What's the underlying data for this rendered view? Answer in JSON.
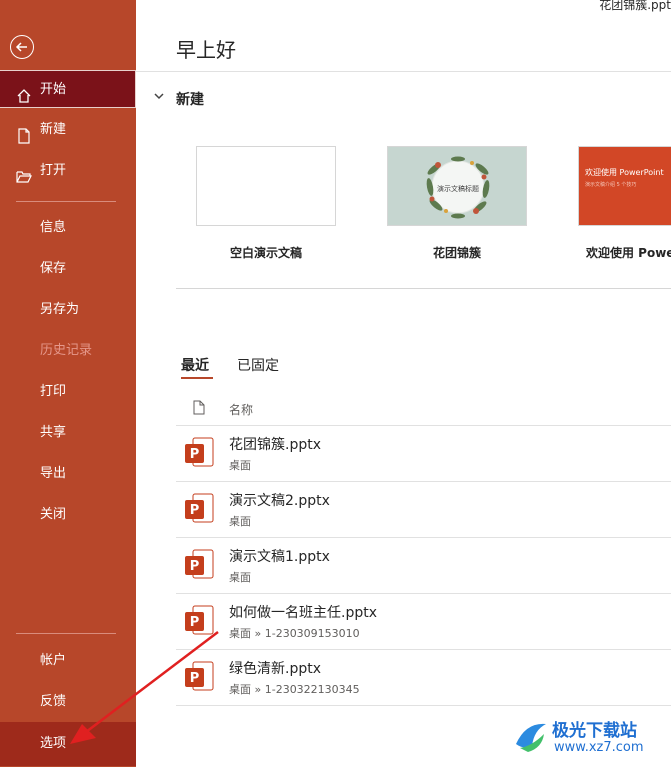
{
  "window": {
    "file_title": "花团锦簇.ppt"
  },
  "sidebar": {
    "items": [
      {
        "label": "开始",
        "icon": "home-icon",
        "state": "active"
      },
      {
        "label": "新建",
        "icon": "new-file-icon"
      },
      {
        "label": "打开",
        "icon": "open-folder-icon"
      },
      {
        "label": "信息"
      },
      {
        "label": "保存"
      },
      {
        "label": "另存为"
      },
      {
        "label": "历史记录",
        "state": "disabled"
      },
      {
        "label": "打印"
      },
      {
        "label": "共享"
      },
      {
        "label": "导出"
      },
      {
        "label": "关闭"
      },
      {
        "label": "帐户"
      },
      {
        "label": "反馈"
      },
      {
        "label": "选项",
        "state": "highlighted"
      }
    ]
  },
  "main": {
    "greeting": "早上好",
    "new_section": {
      "title": "新建",
      "templates": [
        {
          "label": "空白演示文稿"
        },
        {
          "label": "花团锦簇",
          "thumb_text": "演示文稿标题"
        },
        {
          "label": "欢迎使用 Powe",
          "thumb_title": "欢迎使用 PowerPoint",
          "thumb_sub": "演示文稿介绍 5 个技巧"
        }
      ]
    },
    "tabs": [
      {
        "label": "最近",
        "active": true
      },
      {
        "label": "已固定",
        "active": false
      }
    ],
    "column_header": "名称",
    "files": [
      {
        "name": "花团锦簇.pptx",
        "location": "桌面"
      },
      {
        "name": "演示文稿2.pptx",
        "location": "桌面"
      },
      {
        "name": "演示文稿1.pptx",
        "location": "桌面"
      },
      {
        "name": "如何做一名班主任.pptx",
        "location": "桌面 » 1-230309153010"
      },
      {
        "name": "绿色清新.pptx",
        "location": "桌面 » 1-230322130345"
      }
    ]
  },
  "watermark": {
    "text": "极光下载站",
    "url": "www.xz7.com"
  },
  "colors": {
    "sidebar_bg": "#b7472a",
    "active_item_bg": "#7b1219",
    "accent": "#b7472a",
    "annotation_arrow": "#e02020"
  }
}
